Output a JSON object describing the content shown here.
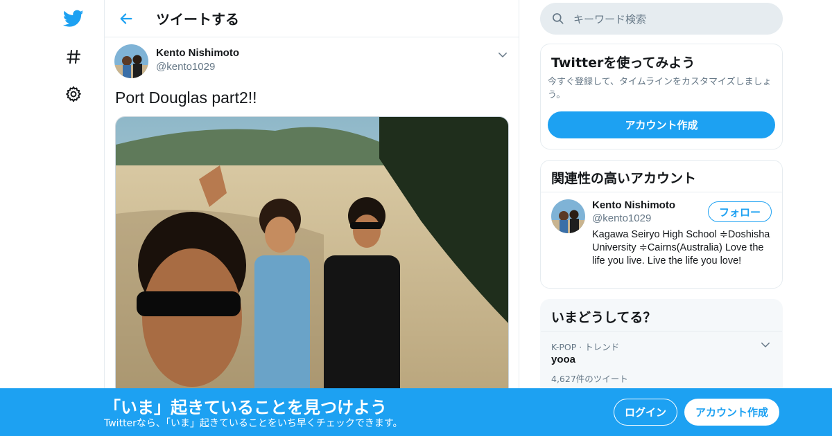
{
  "nav": {
    "twitter_icon": "twitter-bird-icon",
    "explore_icon": "hashtag-icon",
    "settings_icon": "gear-icon"
  },
  "header": {
    "title": "ツイートする"
  },
  "tweet": {
    "author_name": "Kento Nishimoto",
    "author_handle": "@kento1029",
    "text": "Port Douglas part2!!"
  },
  "search": {
    "placeholder": "キーワード検索"
  },
  "signup_card": {
    "title": "Twitterを使ってみよう",
    "description": "今すぐ登録して、タイムラインをカスタマイズしましょう。",
    "button_label": "アカウント作成"
  },
  "related_card": {
    "title": "関連性の高いアカウント",
    "name": "Kento Nishimoto",
    "handle": "@kento1029",
    "follow_label": "フォロー",
    "bio": "Kagawa Seiryo High School ≑Doshisha University ≑Cairns(Australia) Love the life you live. Live the life you love!"
  },
  "trends_card": {
    "title": "いまどうしてる？",
    "trend_meta": "K-POP · トレンド",
    "trend_name": "yooa",
    "trend_count": "4,627件のツイート"
  },
  "banner": {
    "title": "「いま」起きていることを見つけよう",
    "subtitle": "Twitterなら、「いま」起きていることをいち早くチェックできます。",
    "login_label": "ログイン",
    "signup_label": "アカウント作成"
  },
  "colors": {
    "brand": "#1da1f2",
    "border": "#e6ecf0",
    "muted": "#657786"
  }
}
